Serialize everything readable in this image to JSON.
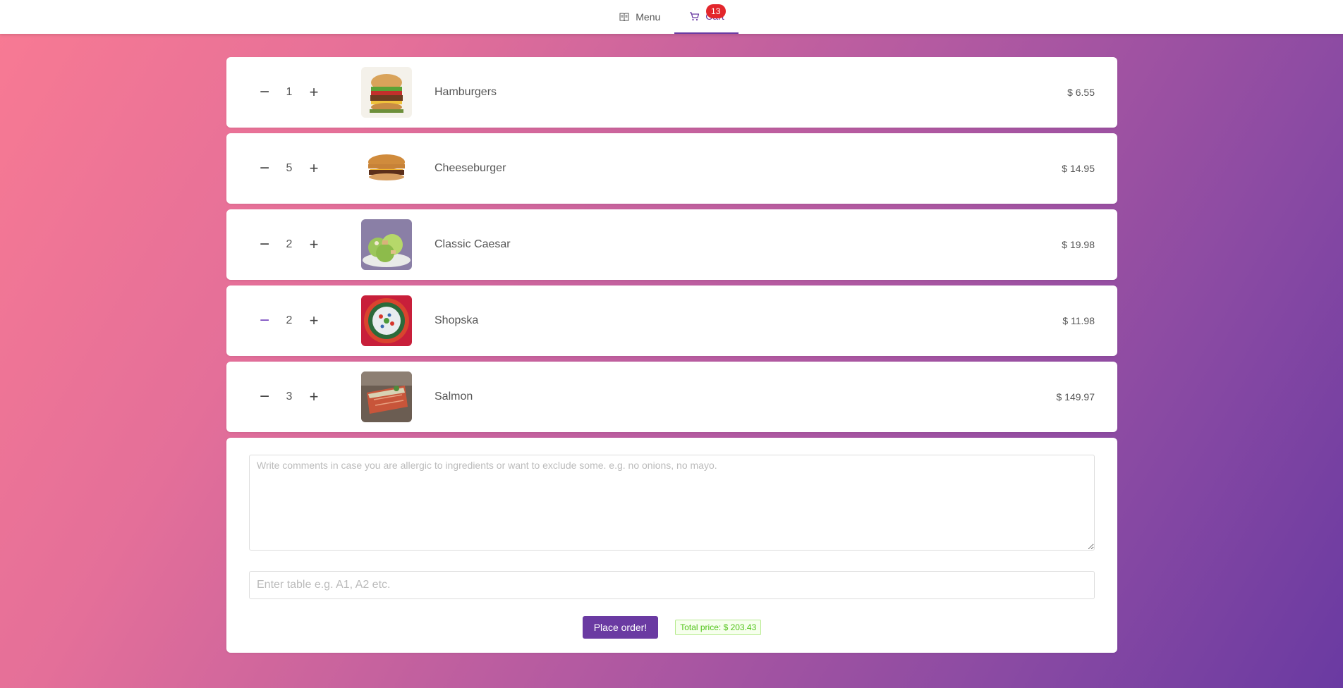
{
  "nav": {
    "menu_label": "Menu",
    "cart_label": "Cart",
    "cart_count": "13"
  },
  "cart": {
    "items": [
      {
        "name": "Hamburgers",
        "qty": "1",
        "price": "$ 6.55",
        "image": "hamburger-photo"
      },
      {
        "name": "Cheeseburger",
        "qty": "5",
        "price": "$ 14.95",
        "image": "cheeseburger-photo"
      },
      {
        "name": "Classic Caesar",
        "qty": "2",
        "price": "$ 19.98",
        "image": "caesar-salad-photo"
      },
      {
        "name": "Shopska",
        "qty": "2",
        "price": "$ 11.98",
        "image": "shopska-salad-photo"
      },
      {
        "name": "Salmon",
        "qty": "3",
        "price": "$ 149.97",
        "image": "salmon-photo"
      }
    ]
  },
  "order": {
    "comments_placeholder": "Write comments in case you are allergic to ingredients or want to exclude some. e.g. no onions, no mayo.",
    "table_placeholder": "Enter table e.g. A1, A2 etc.",
    "place_order_label": "Place order!",
    "total_label": "Total price: $ 203.43"
  },
  "colors": {
    "accent": "#6a3aa2",
    "badge": "#e3262c",
    "total_text": "#52c41a"
  }
}
